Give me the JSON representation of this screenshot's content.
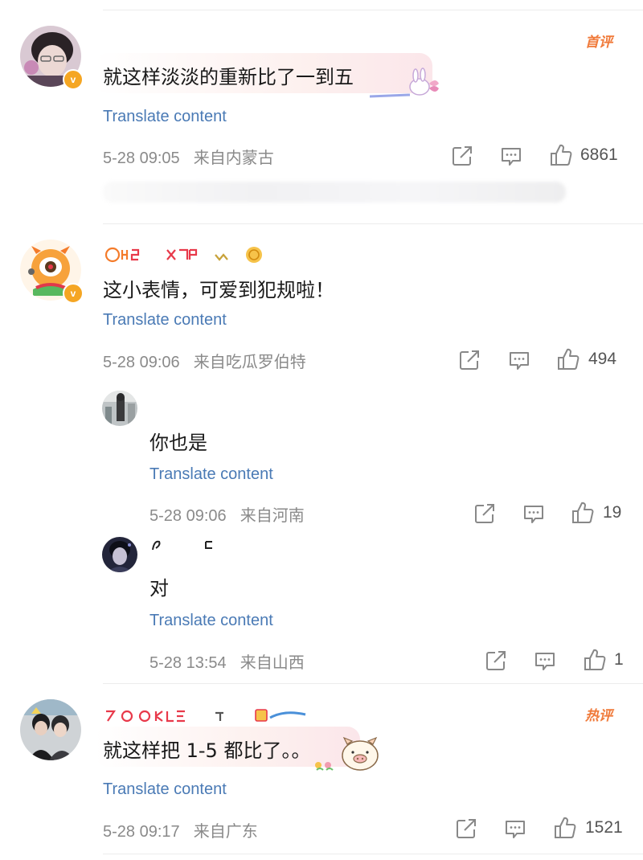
{
  "colors": {
    "translate_link": "#4a7ab5",
    "meta_text": "#8a8a8a",
    "tag_orange": "#f07a3a",
    "verified_badge": "#f5a623"
  },
  "comments": [
    {
      "tag": "首评",
      "text": "就这样淡淡的重新比了一到五",
      "translate": "Translate content",
      "time": "5-28 09:05",
      "source": "来自内蒙古",
      "likes": "6861",
      "verified_badge": "v"
    },
    {
      "text": "这小表情，可爱到犯规啦！",
      "translate": "Translate content",
      "time": "5-28 09:06",
      "source": "来自吃瓜罗伯特",
      "likes": "494",
      "verified_badge": "v",
      "replies": [
        {
          "text": "你也是",
          "translate": "Translate content",
          "time": "5-28 09:06",
          "source": "来自河南",
          "likes": "19"
        },
        {
          "text": "对",
          "translate": "Translate content",
          "time": "5-28 13:54",
          "source": "来自山西",
          "likes": "1"
        }
      ]
    },
    {
      "tag": "热评",
      "text": "就这样把 1-5 都比了。。",
      "translate": "Translate content",
      "time": "5-28 09:17",
      "source": "来自广东",
      "likes": "1521"
    }
  ],
  "icons": {
    "share": "share-icon",
    "comment": "comment-icon",
    "like": "thumbs-up-icon"
  }
}
